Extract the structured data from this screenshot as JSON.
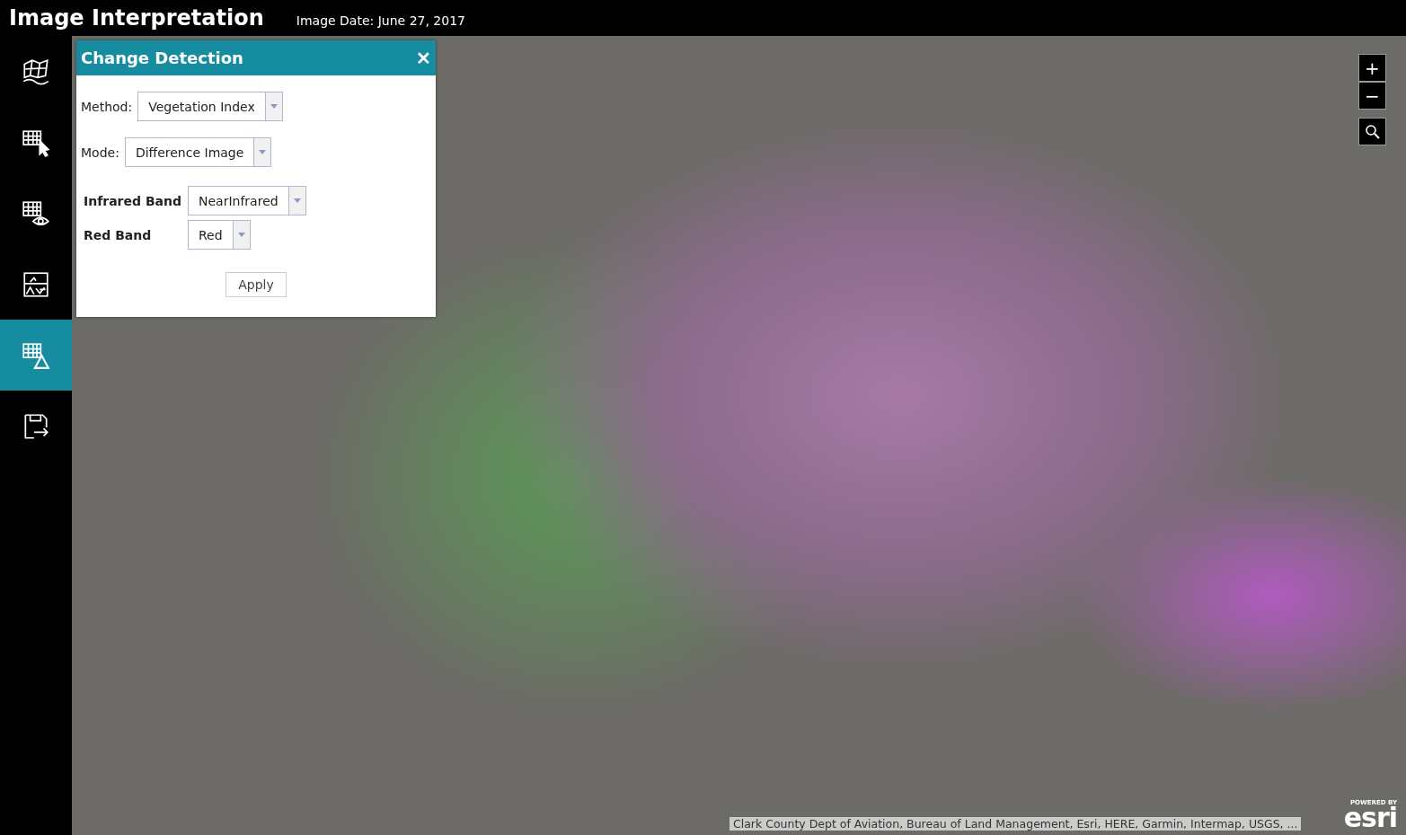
{
  "header": {
    "title": "Image Interpretation",
    "subtitle": "Image Date: June 27, 2017"
  },
  "sidebar": {
    "items": [
      {
        "kind": "map",
        "selected": false
      },
      {
        "kind": "grid-pointer",
        "selected": false
      },
      {
        "kind": "grid-eye",
        "selected": false
      },
      {
        "kind": "compare",
        "selected": false
      },
      {
        "kind": "grid-triangle",
        "selected": true
      },
      {
        "kind": "save-export",
        "selected": false
      }
    ]
  },
  "panel": {
    "title": "Change Detection",
    "close": "✕",
    "fields": [
      {
        "kind": "plain",
        "label": "Method:",
        "value": "Vegetation Index"
      },
      {
        "kind": "plain",
        "label": "Mode:",
        "value": "Difference Image"
      },
      {
        "kind": "band",
        "label": "Infrared Band",
        "value": "NearInfrared"
      },
      {
        "kind": "band",
        "label": "Red Band",
        "value": "Red"
      }
    ],
    "button": "Apply"
  },
  "map_controls": {
    "zoom_in": "+",
    "zoom_out": "−"
  },
  "attribution": "Clark County Dept of Aviation, Bureau of Land Management, Esri, HERE, Garmin, Intermap, USGS, ...",
  "logo": {
    "caption": "POWERED BY",
    "name": "esri"
  }
}
